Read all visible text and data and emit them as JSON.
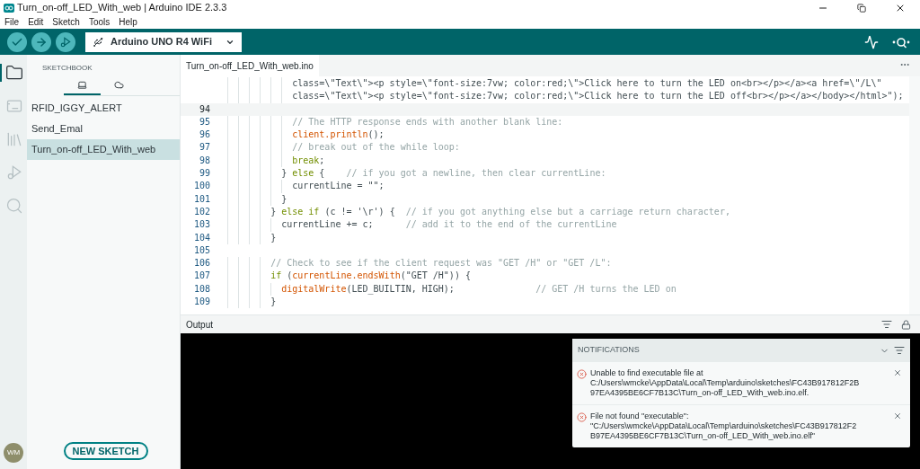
{
  "window": {
    "title": "Turn_on-off_LED_With_web | Arduino IDE 2.3.3"
  },
  "menu": [
    "File",
    "Edit",
    "Sketch",
    "Tools",
    "Help"
  ],
  "toolbar": {
    "board": "Arduino UNO R4 WiFi"
  },
  "activity_bar": [
    {
      "kind": "sketchbook",
      "selected": true
    },
    {
      "kind": "boards",
      "selected": false
    },
    {
      "kind": "library",
      "selected": false
    },
    {
      "kind": "debug",
      "selected": false
    },
    {
      "kind": "search",
      "selected": false
    }
  ],
  "sidebar": {
    "title": "SKETCHBOOK",
    "tabs": [
      {
        "kind": "local",
        "selected": true
      },
      {
        "kind": "cloud",
        "selected": false
      }
    ],
    "items": [
      {
        "label": "RFID_IGGY_ALERT",
        "selected": false
      },
      {
        "label": "Send_Emal",
        "selected": false
      },
      {
        "label": "Turn_on-off_LED_With_web",
        "selected": true
      }
    ],
    "new_sketch": "NEW SKETCH",
    "avatar": "WM"
  },
  "editor": {
    "tab": "Turn_on-off_LED_With_web.ino",
    "lines": [
      {
        "current": false,
        "tokens": [
          {
            "kind": "plain",
            "text": "            class=\\\"Text\\\"><p style=\\\"font-size:7vw; color:red;\\\">Click here to turn the LED on<br></p></a><a href=\\\"/L\\\""
          }
        ]
      },
      {
        "current": false,
        "tokens": [
          {
            "kind": "plain",
            "text": "            class=\\\"Text\\\"><p style=\\\"font-size:7vw; color:red;\\\">Click here to turn the LED off<br></p></a></body></html>\");"
          }
        ]
      },
      {
        "number": "94",
        "current": true
      },
      {
        "number": "95",
        "current": false,
        "tokens": [
          {
            "kind": "comment",
            "text": "            // The HTTP response ends with another blank line:"
          }
        ]
      },
      {
        "number": "96",
        "current": false,
        "tokens": [
          {
            "kind": "function",
            "text": "            client.println"
          },
          {
            "kind": "plain",
            "text": "();"
          }
        ]
      },
      {
        "number": "97",
        "current": false,
        "tokens": [
          {
            "kind": "comment",
            "text": "            // break out of the while loop:"
          }
        ]
      },
      {
        "number": "98",
        "current": false,
        "tokens": [
          {
            "kind": "keyword",
            "text": "            break"
          },
          {
            "kind": "plain",
            "text": ";"
          }
        ]
      },
      {
        "number": "99",
        "current": false,
        "tokens": [
          {
            "kind": "plain",
            "text": "          } "
          },
          {
            "kind": "keyword",
            "text": "else"
          },
          {
            "kind": "plain",
            "text": " {    "
          },
          {
            "kind": "comment",
            "text": "// if you got a newline, then clear currentLine:"
          }
        ]
      },
      {
        "number": "100",
        "current": false,
        "tokens": [
          {
            "kind": "plain",
            "text": "            currentLine = \"\";"
          }
        ]
      },
      {
        "number": "101",
        "current": false,
        "tokens": [
          {
            "kind": "plain",
            "text": "          }"
          }
        ]
      },
      {
        "number": "102",
        "current": false,
        "tokens": [
          {
            "kind": "plain",
            "text": "        } "
          },
          {
            "kind": "keyword",
            "text": "else if"
          },
          {
            "kind": "plain",
            "text": " (c != '\\r') {  "
          },
          {
            "kind": "comment",
            "text": "// if you got anything else but a carriage return character,"
          }
        ]
      },
      {
        "number": "103",
        "current": false,
        "tokens": [
          {
            "kind": "plain",
            "text": "          currentLine += c;      "
          },
          {
            "kind": "comment",
            "text": "// add it to the end of the currentLine"
          }
        ]
      },
      {
        "number": "104",
        "current": false,
        "tokens": [
          {
            "kind": "plain",
            "text": "        }"
          }
        ]
      },
      {
        "number": "105",
        "current": false
      },
      {
        "number": "106",
        "current": false,
        "tokens": [
          {
            "kind": "comment",
            "text": "        // Check to see if the client request was \"GET /H\" or \"GET /L\":"
          }
        ]
      },
      {
        "number": "107",
        "current": false,
        "tokens": [
          {
            "kind": "keyword",
            "text": "        if"
          },
          {
            "kind": "plain",
            "text": " ("
          },
          {
            "kind": "function",
            "text": "currentLine.endsWith"
          },
          {
            "kind": "plain",
            "text": "(\"GET /H\")) {"
          }
        ]
      },
      {
        "number": "108",
        "current": false,
        "tokens": [
          {
            "kind": "function",
            "text": "          digitalWrite"
          },
          {
            "kind": "plain",
            "text": "(LED_BUILTIN, HIGH);               "
          },
          {
            "kind": "comment",
            "text": "// GET /H turns the LED on"
          }
        ]
      },
      {
        "number": "109",
        "current": false,
        "tokens": [
          {
            "kind": "plain",
            "text": "        }"
          }
        ]
      }
    ]
  },
  "output": {
    "title": "Output"
  },
  "notifications": {
    "title": "NOTIFICATIONS",
    "items": [
      {
        "lines": [
          "Unable to find executable file at",
          "C:/Users\\wmcke\\AppData\\Local\\Temp\\arduino\\sketches\\FC43B917812F2B",
          "97EA4395BE6CF7B13C\\Turn_on-off_LED_With_web.ino.elf."
        ]
      },
      {
        "lines": [
          "File not found \"executable\":",
          "\"C:/Users\\wmcke\\AppData\\Local\\Temp\\arduino\\sketches\\FC43B917812F2",
          "B97EA4395BE6CF7B13C\\Turn_on-off_LED_With_web.ino.elf\""
        ]
      }
    ]
  }
}
